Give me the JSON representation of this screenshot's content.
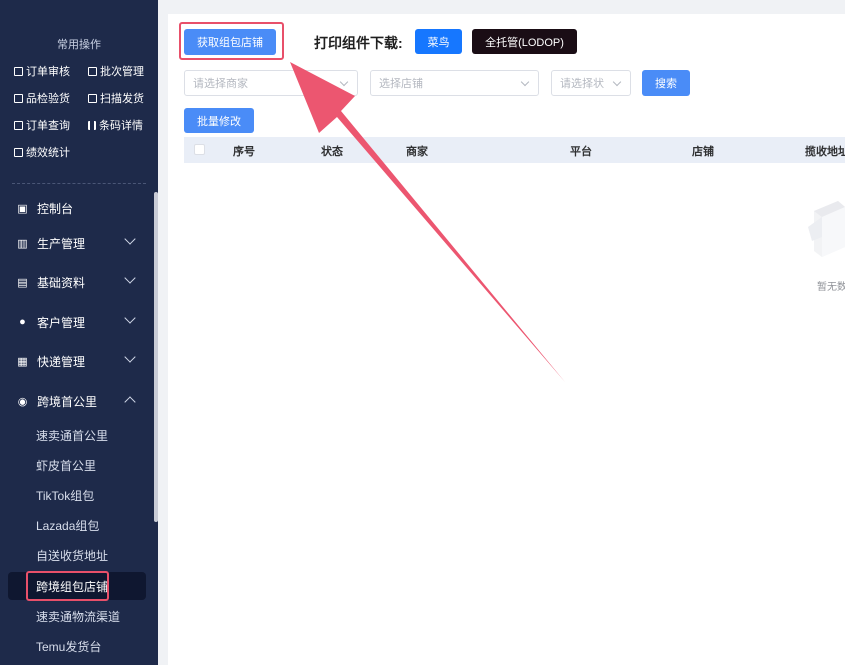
{
  "sidebar": {
    "quick_title": "常用操作",
    "quick_items": [
      {
        "label": "订单审核",
        "icon": "checkbox-icon"
      },
      {
        "label": "批次管理",
        "icon": "batch-icon"
      },
      {
        "label": "品检验货",
        "icon": "inspect-icon"
      },
      {
        "label": "扫描发货",
        "icon": "scan-icon"
      },
      {
        "label": "订单查询",
        "icon": "search-doc-icon"
      },
      {
        "label": "条码详情",
        "icon": "barcode-icon"
      },
      {
        "label": "绩效统计",
        "icon": "chart-icon"
      }
    ],
    "menu": [
      {
        "label": "控制台",
        "icon": "dashboard-icon"
      },
      {
        "label": "生产管理",
        "icon": "production-icon"
      },
      {
        "label": "基础资料",
        "icon": "database-icon"
      },
      {
        "label": "客户管理",
        "icon": "customer-icon"
      },
      {
        "label": "快递管理",
        "icon": "calendar-icon"
      },
      {
        "label": "跨境首公里",
        "icon": "globe-icon"
      }
    ],
    "sub_items": [
      {
        "label": "速卖通首公里"
      },
      {
        "label": "虾皮首公里"
      },
      {
        "label": "TikTok组包"
      },
      {
        "label": "Lazada组包"
      },
      {
        "label": "自送收货地址"
      },
      {
        "label": "跨境组包店铺",
        "active": true
      },
      {
        "label": "速卖通物流渠道"
      },
      {
        "label": "Temu发货台"
      }
    ]
  },
  "toolbar": {
    "fetch_store_label": "获取组包店铺",
    "print_label": "打印组件下载:",
    "cainiao_label": "菜鸟",
    "lodop_label": "全托管(LODOP)"
  },
  "filters": {
    "merchant_placeholder": "请选择商家",
    "store_placeholder": "选择店铺",
    "status_placeholder": "请选择状",
    "search_label": "搜索",
    "batch_edit_label": "批量修改"
  },
  "table": {
    "columns": [
      "序号",
      "状态",
      "商家",
      "平台",
      "店铺",
      "揽收地址"
    ],
    "rows": [],
    "empty_text": "暂无数据"
  },
  "colors": {
    "sidebar_bg": "#1e2a4a",
    "primary": "#4a8cf7",
    "highlight": "#e8506a"
  }
}
